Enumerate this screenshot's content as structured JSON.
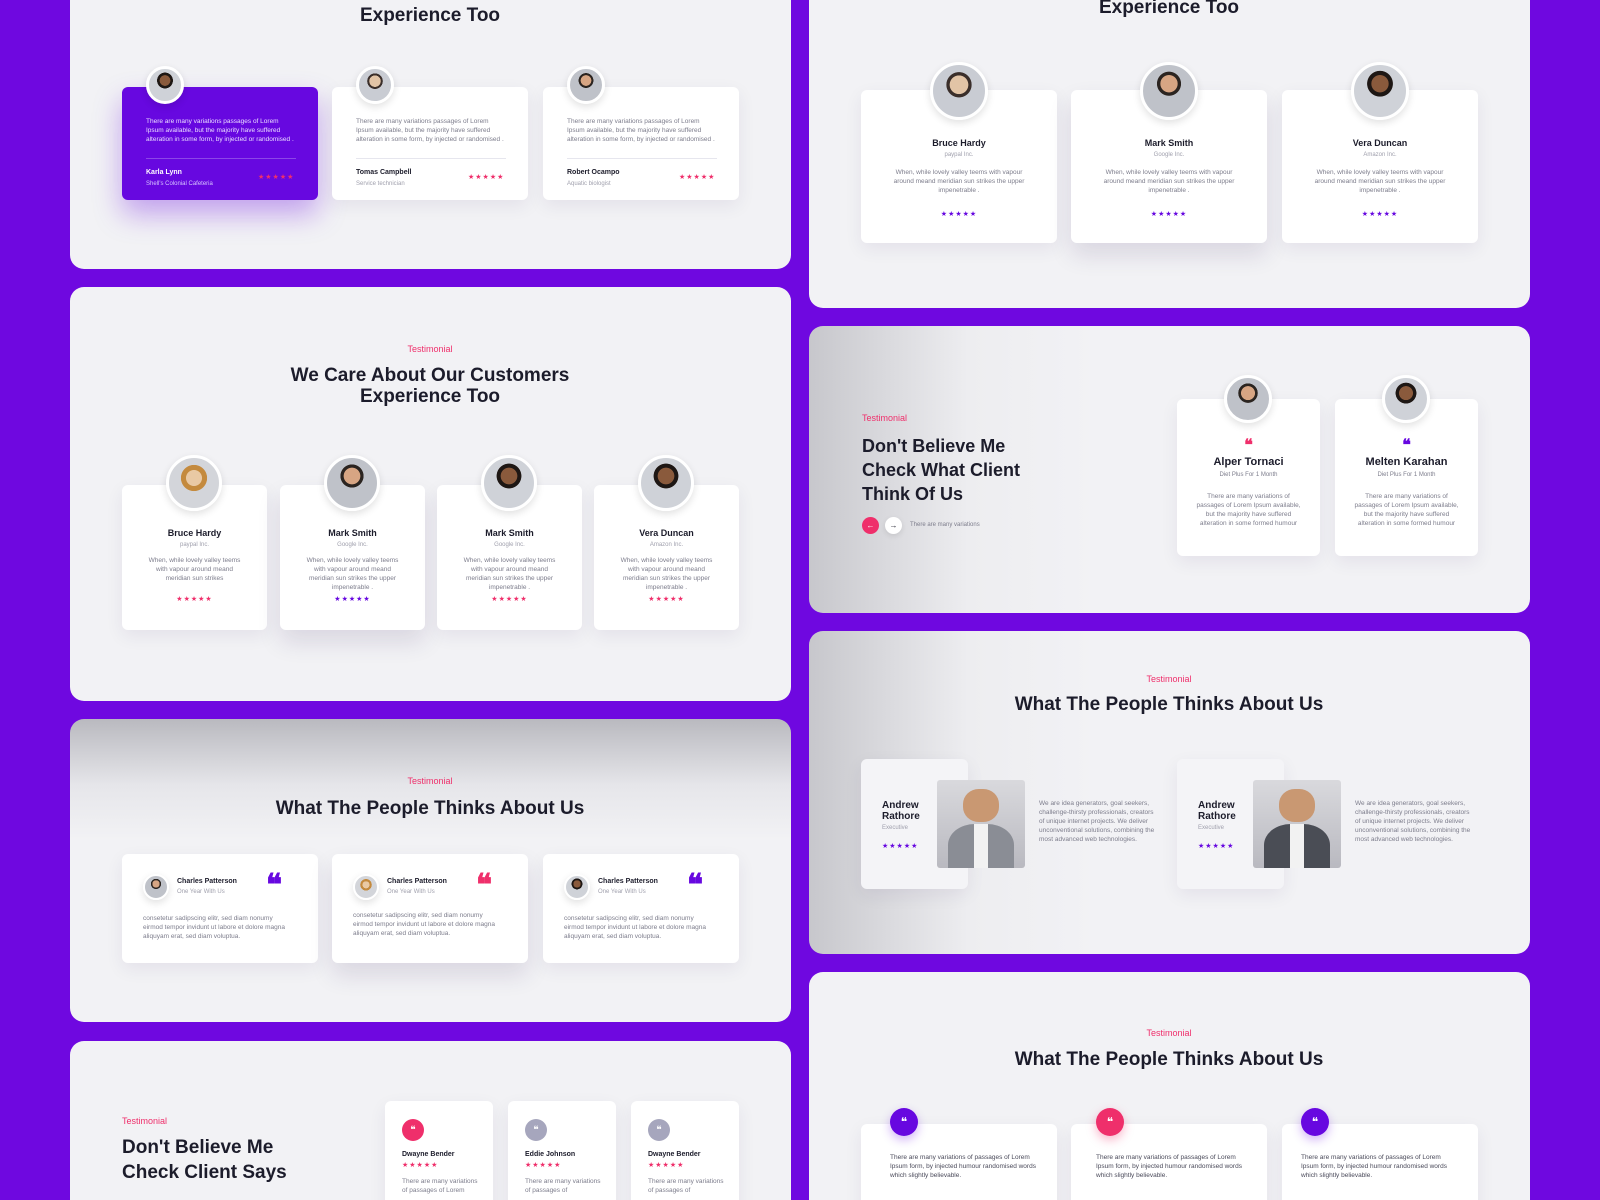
{
  "p1": {
    "title": "We Care About Our Customers Experience Too",
    "cards": [
      {
        "text": "There are many variations passages of Lorem Ipsum available, but the majority have suffered alteration in some form, by injected or randomised .",
        "name": "Karla Lynn",
        "role": "Shell's Colonial Cafeteria",
        "stars": "★★★★★"
      },
      {
        "text": "There are many variations passages of Lorem Ipsum available, but the majority have suffered alteration in some form, by injected or randomised .",
        "name": "Tomas Campbell",
        "role": "Service technician",
        "stars": "★★★★★"
      },
      {
        "text": "There are many variations passages of Lorem Ipsum available, but the majority have suffered alteration in some form, by injected or randomised .",
        "name": "Robert Ocampo",
        "role": "Aquatic biologist",
        "stars": "★★★★★"
      }
    ]
  },
  "p2": {
    "tag": "Testimonial",
    "title": "We Care About Our Customers Experience Too",
    "cards": [
      {
        "name": "Bruce Hardy",
        "company": "paypal Inc.",
        "text": "When, while lovely valley teems with vapour around meand meridian sun strikes",
        "stars": "★★★★★"
      },
      {
        "name": "Mark Smith",
        "company": "Google Inc.",
        "text": "When, while lovely valley teems with vapour around meand meridian sun strikes the upper impenetrable .",
        "stars": "★★★★★"
      },
      {
        "name": "Mark Smith",
        "company": "Google Inc.",
        "text": "When, while lovely valley teems with vapour around meand meridian sun strikes the upper impenetrable .",
        "stars": "★★★★★"
      },
      {
        "name": "Vera Duncan",
        "company": "Amazon Inc.",
        "text": "When, while lovely valley teems with vapour around meand meridian sun strikes the upper impenetrable .",
        "stars": "★★★★★"
      }
    ]
  },
  "p3": {
    "tag": "Testimonial",
    "title": "What The People Thinks About Us",
    "cards": [
      {
        "name": "Charles Patterson",
        "since": "One Year With Us",
        "text": "consetetur sadipscing elitr, sed diam nonumy eirmod tempor invidunt ut labore et dolore magna aliquyam erat, sed diam voluptua."
      },
      {
        "name": "Charles Patterson",
        "since": "One Year With Us",
        "text": "consetetur sadipscing elitr, sed diam nonumy eirmod tempor invidunt ut labore et dolore magna aliquyam erat, sed diam voluptua."
      },
      {
        "name": "Charles Patterson",
        "since": "One Year With Us",
        "text": "consetetur sadipscing elitr, sed diam nonumy eirmod tempor invidunt ut labore et dolore magna aliquyam erat, sed diam voluptua."
      }
    ]
  },
  "p4": {
    "tag": "Testimonial",
    "title": "Don't Believe Me Check Client Says",
    "cards": [
      {
        "name": "Dwayne Bender",
        "stars": "★★★★★",
        "text": "There are many variations of passages of Lorem"
      },
      {
        "name": "Eddie Johnson",
        "stars": "★★★★★",
        "text": "There are many variations of passages of"
      },
      {
        "name": "Dwayne Bender",
        "stars": "★★★★★",
        "text": "There are many variations of passages of"
      }
    ]
  },
  "p5": {
    "title": "Experience Too",
    "cards": [
      {
        "name": "Bruce Hardy",
        "company": "paypal Inc.",
        "text": "When, while lovely valley teems with vapour around meand meridian sun strikes the upper impenetrable .",
        "stars": "★★★★★"
      },
      {
        "name": "Mark Smith",
        "company": "Google Inc.",
        "text": "When, while lovely valley teems with vapour around meand meridian sun strikes the upper impenetrable .",
        "stars": "★★★★★"
      },
      {
        "name": "Vera Duncan",
        "company": "Amazon Inc.",
        "text": "When, while lovely valley teems with vapour around meand meridian sun strikes the upper impenetrable .",
        "stars": "★★★★★"
      }
    ]
  },
  "p6": {
    "tag": "Testimonial",
    "title": "Don't Believe Me Check What Client Think Of Us",
    "nav_text": "There are many variations",
    "cards": [
      {
        "name": "Alper Tornaci",
        "plan": "Diet Plus For 1 Month",
        "text": "There are many variations of passages of Lorem Ipsum available, but the majority have suffered alteration in some formed humour"
      },
      {
        "name": "Melten Karahan",
        "plan": "Diet Plus For 1 Month",
        "text": "There are many variations of passages of Lorem Ipsum available, but the majority have suffered alteration in some formed humour"
      }
    ]
  },
  "p7": {
    "tag": "Testimonial",
    "title": "What The People Thinks About Us",
    "items": [
      {
        "first": "Andrew",
        "last": "Rathore",
        "role": "Executive",
        "stars": "★★★★★",
        "text": "We are idea generators, goal seekers, challenge-thirsty professionals, creators of unique internet projects. We deliver unconventional solutions, combining the most advanced web technologies."
      },
      {
        "first": "Andrew",
        "last": "Rathore",
        "role": "Executive",
        "stars": "★★★★★",
        "text": "We are idea generators, goal seekers, challenge-thirsty professionals, creators of unique internet projects. We deliver unconventional solutions, combining the most advanced web technologies."
      }
    ]
  },
  "p8": {
    "tag": "Testimonial",
    "title": "What The People Thinks About Us",
    "cards": [
      {
        "text": "There are many variations of passages of Lorem Ipsum form, by injected humour randomised words which slightly believable."
      },
      {
        "text": "There are many variations of passages of Lorem Ipsum form, by injected humour randomised words which slightly believable."
      },
      {
        "text": "There are many variations of passages of Lorem Ipsum form, by injected humour randomised words which slightly believable."
      }
    ]
  },
  "icons": {
    "quote": "❝",
    "left_arrow": "←",
    "right_arrow": "→"
  },
  "colors": {
    "background": "#6f08e0",
    "accent_purple": "#6708e0",
    "accent_pink": "#ef2f6b"
  }
}
